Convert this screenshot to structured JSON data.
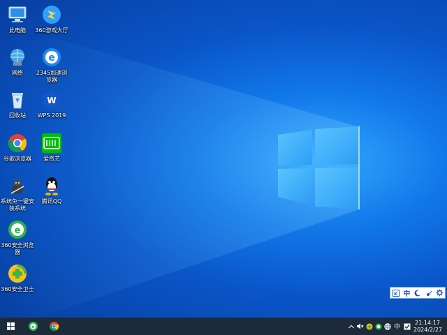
{
  "desktop": {
    "icons": [
      {
        "label": "此电脑",
        "icon": "computer-icon"
      },
      {
        "label": "360游戏大厅",
        "icon": "360-game-icon"
      },
      {
        "label": "网络",
        "icon": "network-icon"
      },
      {
        "label": "2345加速浏览器",
        "icon": "2345-browser-icon"
      },
      {
        "label": "回收站",
        "icon": "recycle-bin-icon"
      },
      {
        "label": "WPS 2019",
        "icon": "wps-icon"
      },
      {
        "label": "谷歌浏览器",
        "icon": "chrome-icon"
      },
      {
        "label": "爱奇艺",
        "icon": "iqiyi-icon"
      },
      {
        "label": "系统免一键安装系统",
        "icon": "system-install-icon"
      },
      {
        "label": "腾讯QQ",
        "icon": "qq-icon"
      },
      {
        "label": "360安全浏览器",
        "icon": "360-browser-icon"
      },
      {
        "label": "360安全卫士",
        "icon": "360-security-icon"
      }
    ]
  },
  "ime_bar": {
    "items": [
      {
        "label": "",
        "icon": "arrow-icon"
      },
      {
        "label": "中",
        "icon": ""
      },
      {
        "label": "",
        "icon": "moon-icon"
      },
      {
        "label": "",
        "icon": "dot-icon"
      },
      {
        "label": "",
        "icon": "gear-icon"
      }
    ]
  },
  "taskbar": {
    "apps": [
      {
        "icon": "start-icon"
      },
      {
        "icon": "360-browser-icon"
      },
      {
        "icon": "chrome-icon"
      }
    ],
    "tray": {
      "ime_label": "中",
      "time": "21:14:17",
      "date": "2024/2/27"
    }
  },
  "colors": {
    "taskbar": "#1c2a3a",
    "wallpaper": "#1177e8"
  }
}
